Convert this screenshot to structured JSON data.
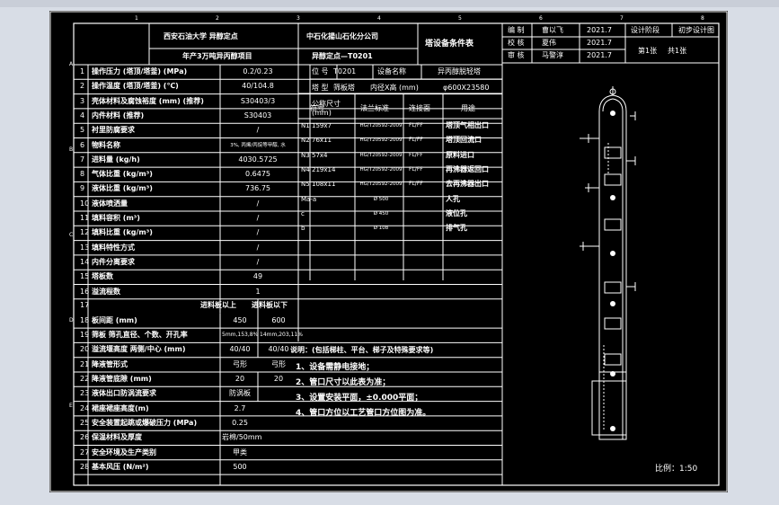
{
  "header": {
    "school": "西安石油大学 异醇定点",
    "project": "年产3万吨异丙醇项目",
    "company": "中石化揚山石化分公司",
    "drawing_no": "异醇定点—T0201",
    "doc_title": "塔设备条件表"
  },
  "sign_block": {
    "rows": [
      {
        "role": "编 制",
        "name": "曹以飞",
        "date": "2021.7"
      },
      {
        "role": "校 核",
        "name": "夏伟",
        "date": "2021.7"
      },
      {
        "role": "审 核",
        "name": "马警淳",
        "date": "2021.7"
      }
    ],
    "stage_label": "设计阶段",
    "stage_value": "初步设计图",
    "sheet": "第1张",
    "total": "共1张"
  },
  "equip": {
    "tag_label": "位 号",
    "tag_value": "T0201",
    "name_label": "设备名称",
    "name_value": "异丙醇脱轻塔",
    "type_label": "塔 型",
    "type_value": "筛板塔",
    "dia_label": "内径X高 (mm)",
    "dia_value": "φ600X23580"
  },
  "nozzle_head": {
    "sym": "符号",
    "dn": "公称尺寸(mm)",
    "std": "法兰标准",
    "face": "连接面",
    "use": "用途"
  },
  "nozzles": [
    {
      "sym": "N1",
      "dn": "159x7",
      "std": "HG/T20592-2009",
      "face": "FL/FF",
      "use": "塔顶气相出口"
    },
    {
      "sym": "N2",
      "dn": "76x11",
      "std": "HG/T20592-2009",
      "face": "FL/FF",
      "use": "塔顶回流口"
    },
    {
      "sym": "N3",
      "dn": "57x4",
      "std": "HG/T20592-2009",
      "face": "FL/FF",
      "use": "原料进口"
    },
    {
      "sym": "N4",
      "dn": "219x14",
      "std": "HG/T20592-2009",
      "face": "FL/FF",
      "use": "再沸器返回口"
    },
    {
      "sym": "N5",
      "dn": "108x11",
      "std": "HG/T20592-2009",
      "face": "FL/FF",
      "use": "去再沸器出口"
    },
    {
      "sym": "Ma-a",
      "dn": "",
      "std": "Ø 500",
      "face": "",
      "use": "人孔"
    },
    {
      "sym": "c",
      "dn": "",
      "std": "Ø 450",
      "face": "",
      "use": "液位孔"
    },
    {
      "sym": "b",
      "dn": "",
      "std": "Ø 108",
      "face": "",
      "use": "排气孔"
    }
  ],
  "params": [
    {
      "no": "1",
      "label": "操作压力 (塔顶/塔釜)  (MPa)",
      "value": "0.2/0.23"
    },
    {
      "no": "2",
      "label": "操作温度 (塔顶/塔釜)  (℃)",
      "value": "40/104.8"
    },
    {
      "no": "3",
      "label": "壳体材料及腐蚀裕度 (mm) (推荐)",
      "value": "S30403/3"
    },
    {
      "no": "4",
      "label": "内件材料 (推荐)",
      "value": "S30403"
    },
    {
      "no": "5",
      "label": "衬里防腐要求",
      "value": "/"
    },
    {
      "no": "6",
      "label": "物料名称",
      "value": "3%, 丙烯/丙烷等甲醇, 水"
    },
    {
      "no": "7",
      "label": "进料量 (kg/h)",
      "value": "4030.5725"
    },
    {
      "no": "8",
      "label": "气体比重 (kg/m³)",
      "value": "0.6475"
    },
    {
      "no": "9",
      "label": "液体比重 (kg/m³)",
      "value": "736.75"
    },
    {
      "no": "10",
      "label": "液体喷洒量",
      "value": "/"
    },
    {
      "no": "11",
      "label": "填料容积 (m³)",
      "value": "/"
    },
    {
      "no": "12",
      "label": "填料比重 (kg/m³)",
      "value": "/"
    },
    {
      "no": "13",
      "label": "填料特性方式",
      "value": "/"
    },
    {
      "no": "14",
      "label": "内件分离要求",
      "value": "/"
    },
    {
      "no": "15",
      "label": "塔板数",
      "value": "49"
    },
    {
      "no": "16",
      "label": "溢流程数",
      "value": "1"
    }
  ],
  "lower_head": {
    "no": "17",
    "col_a": "进料板以上",
    "col_b": "进料板以下"
  },
  "lower_rows": [
    {
      "no": "18",
      "label": "板间距 (mm)",
      "a": "450",
      "b": "600"
    },
    {
      "no": "19",
      "label": "筛板 筛孔直径、个数、开孔率",
      "a": "5mm,153,8%",
      "b": "14mm,203,11%"
    },
    {
      "no": "20",
      "label": "溢流堰高度 两侧/中心 (mm)",
      "a": "40/40",
      "b": "40/40"
    },
    {
      "no": "21",
      "label": "降液管形式",
      "a": "弓形",
      "b": "弓形"
    },
    {
      "no": "22",
      "label": "降液管底隙 (mm)",
      "a": "20",
      "b": "20"
    },
    {
      "no": "23",
      "label": "液体出口防涡流要求",
      "a": "防涡板",
      "b": ""
    },
    {
      "no": "24",
      "label": "裙座裙座高度(m)",
      "a": "2.7",
      "b": ""
    },
    {
      "no": "25",
      "label": "安全装置起跳或爆破压力 (MPa)",
      "a": "0.25",
      "b": ""
    },
    {
      "no": "26",
      "label": "保温材料及厚度",
      "a": "岩棉/50mm",
      "b": ""
    },
    {
      "no": "27",
      "label": "安全环境及生产类别",
      "a": "甲类",
      "b": ""
    },
    {
      "no": "28",
      "label": "基本风压 (N/m²)",
      "a": "500",
      "b": ""
    }
  ],
  "notes": {
    "title": "说明：(包括梯柱、平台、梯子及特殊要求等)",
    "items": [
      "1、设备需静电接地；",
      "2、管口尺寸以此表为准；",
      "3、设置安装平面，±0.000平面；",
      "4、管口方位以工艺管口方位图为准。"
    ]
  },
  "scale": "比例：1:50",
  "frame_marks": {
    "left": [
      "A",
      "B",
      "C",
      "D",
      "E"
    ],
    "top": [
      "1",
      "2",
      "3",
      "4",
      "5",
      "6",
      "7",
      "8"
    ]
  },
  "colors": {
    "line": "#ffffff",
    "paper": "#000000",
    "canvas": "#d8dde6"
  }
}
